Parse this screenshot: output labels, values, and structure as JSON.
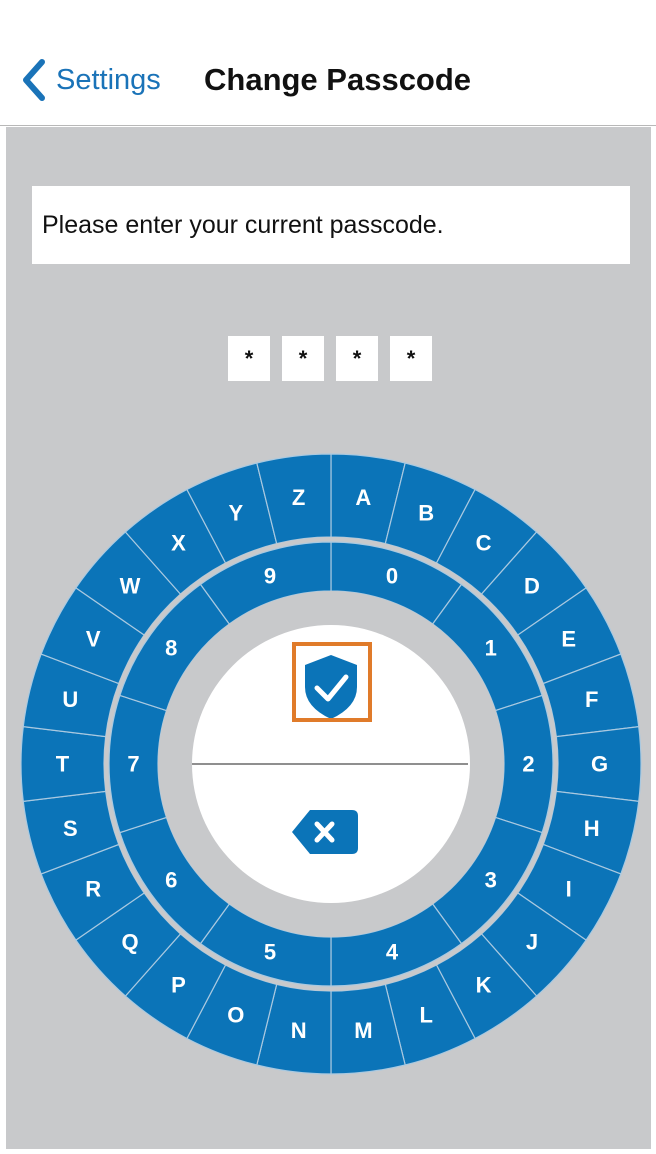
{
  "header": {
    "back_label": "Settings",
    "title": "Change Passcode"
  },
  "prompt": {
    "text": "Please enter your current passcode."
  },
  "passcode": {
    "digits": [
      "*",
      "*",
      "*",
      "*"
    ]
  },
  "dial": {
    "letters": [
      "A",
      "B",
      "C",
      "D",
      "E",
      "F",
      "G",
      "H",
      "I",
      "J",
      "K",
      "L",
      "M",
      "N",
      "O",
      "P",
      "Q",
      "R",
      "S",
      "T",
      "U",
      "V",
      "W",
      "X",
      "Y",
      "Z"
    ],
    "numbers": [
      "0",
      "1",
      "2",
      "3",
      "4",
      "5",
      "6",
      "7",
      "8",
      "9"
    ]
  },
  "center": {
    "confirm_icon": "shield-check-icon",
    "delete_icon": "backspace-icon"
  },
  "colors": {
    "accent_blue": "#0b74b8",
    "background_gray": "#c8c9cb",
    "highlight_orange": "#e07b2a",
    "link_blue": "#1a73b8"
  }
}
